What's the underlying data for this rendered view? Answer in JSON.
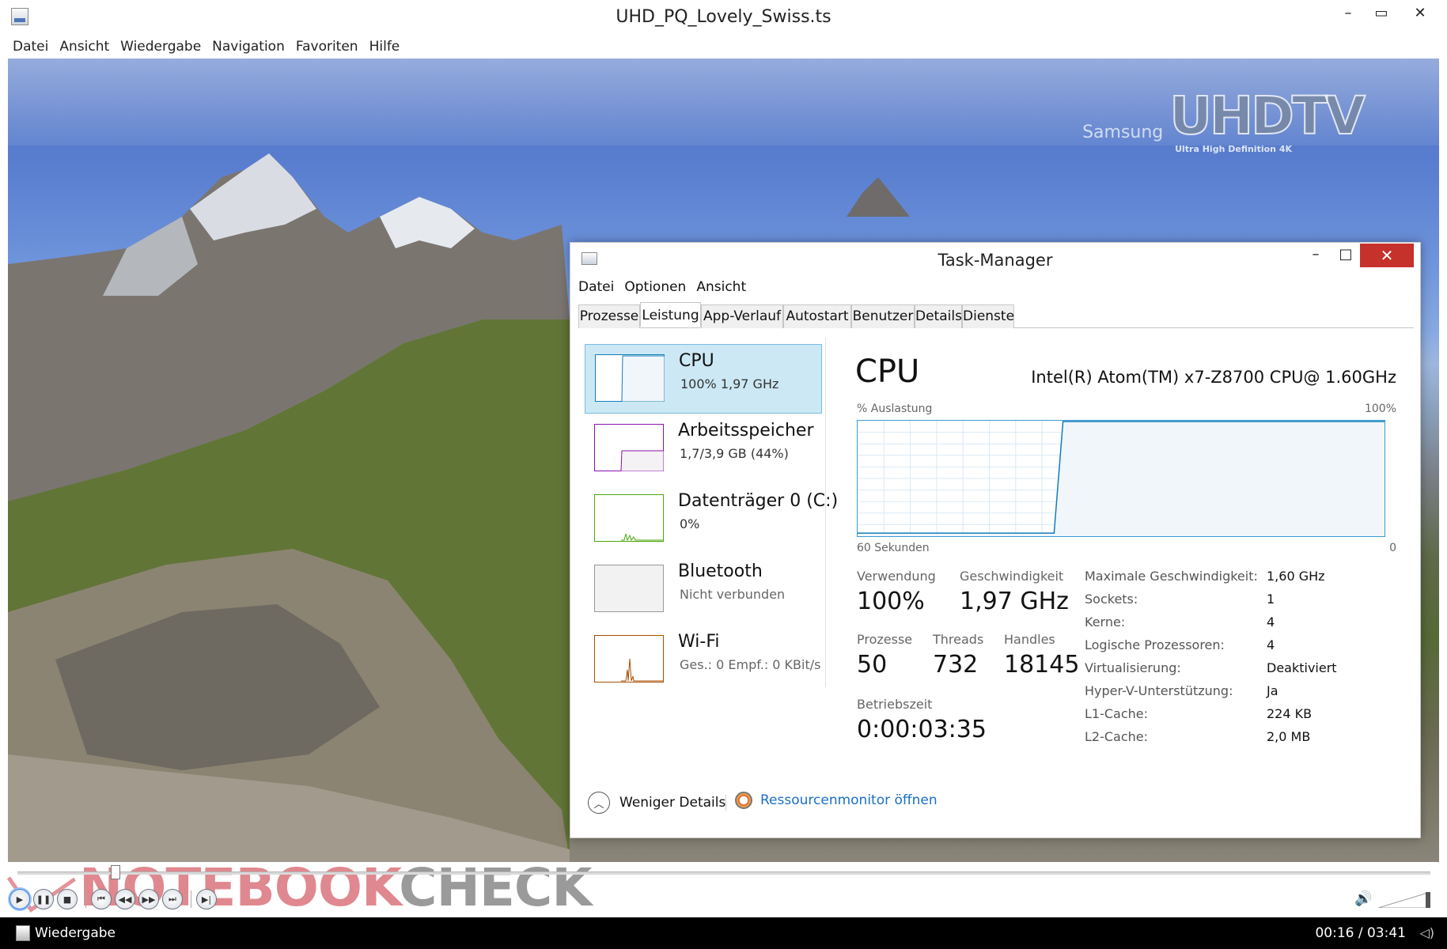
{
  "player": {
    "window_title": "UHD_PQ_Lovely_Swiss.ts",
    "controls": {
      "minimize": "–",
      "maximize": "▭",
      "close": "✕"
    },
    "menu": [
      "Datei",
      "Ansicht",
      "Wiedergabe",
      "Navigation",
      "Favoriten",
      "Hilfe"
    ],
    "brand": {
      "samsung": "Samsung",
      "uhdtv": "UHDTV",
      "sub": "Ultra High Definition 4K"
    },
    "watermark": {
      "left": "NOTEBOOK",
      "right": "CHECK"
    },
    "status": {
      "state": "Wiedergabe",
      "time": "00:16 / 03:41"
    },
    "icons": [
      "play-icon",
      "pause-icon",
      "stop-icon",
      "skip-back-icon",
      "rewind-icon",
      "forward-icon",
      "skip-forward-icon",
      "frame-step-icon",
      "volume-icon"
    ]
  },
  "taskmanager": {
    "title": "Task-Manager",
    "controls": {
      "minimize": "–",
      "maximize": "□",
      "close": "✕"
    },
    "menu": [
      "Datei",
      "Optionen",
      "Ansicht"
    ],
    "tabs": [
      "Prozesse",
      "Leistung",
      "App-Verlauf",
      "Autostart",
      "Benutzer",
      "Details",
      "Dienste"
    ],
    "active_tab": "Leistung",
    "sidebar": [
      {
        "name": "CPU",
        "sub": "100%  1,97 GHz",
        "color": "#117dbb",
        "selected": true
      },
      {
        "name": "Arbeitsspeicher",
        "sub": "1,7/3,9 GB (44%)",
        "color": "#8b12ae"
      },
      {
        "name": "Datenträger 0 (C:)",
        "sub": "0%",
        "color": "#4da60c"
      },
      {
        "name": "Bluetooth",
        "sub": "Nicht verbunden",
        "color": "#999999"
      },
      {
        "name": "Wi-Fi",
        "sub": "Ges.: 0  Empf.: 0 KBit/s",
        "color": "#a74f01"
      }
    ],
    "cpu": {
      "heading": "CPU",
      "model": "Intel(R) Atom(TM) x7-Z8700 CPU@ 1.60GHz",
      "graph_label_left": "% Auslastung",
      "graph_label_right": "100%",
      "axis_left": "60 Sekunden",
      "axis_right": "0",
      "usage_history_percent": [
        2,
        2,
        2,
        2,
        2,
        2,
        2,
        2,
        2,
        2,
        2,
        2,
        2,
        2,
        2,
        2,
        2,
        2,
        2,
        2,
        2,
        2,
        2,
        100,
        100,
        100,
        100,
        100,
        100,
        100,
        100,
        100,
        100,
        100,
        100,
        100,
        100,
        100,
        100,
        100,
        100,
        100,
        100,
        100,
        100,
        100,
        100,
        100,
        100,
        100,
        100,
        100,
        100,
        100,
        100,
        100,
        100,
        100,
        100,
        100
      ],
      "stats": {
        "usage_label": "Verwendung",
        "usage": "100%",
        "speed_label": "Geschwindigkeit",
        "speed": "1,97 GHz",
        "processes_label": "Prozesse",
        "processes": "50",
        "threads_label": "Threads",
        "threads": "732",
        "handles_label": "Handles",
        "handles": "18145",
        "uptime_label": "Betriebszeit",
        "uptime": "0:00:03:35"
      },
      "details": [
        {
          "k": "Maximale Geschwindigkeit:",
          "v": "1,60 GHz"
        },
        {
          "k": "Sockets:",
          "v": "1"
        },
        {
          "k": "Kerne:",
          "v": "4"
        },
        {
          "k": "Logische Prozessoren:",
          "v": "4"
        },
        {
          "k": "Virtualisierung:",
          "v": "Deaktiviert"
        },
        {
          "k": "Hyper-V-Unterstützung:",
          "v": "Ja"
        },
        {
          "k": "L1-Cache:",
          "v": "224 KB"
        },
        {
          "k": "L2-Cache:",
          "v": "2,0 MB"
        }
      ]
    },
    "footer": {
      "fewer_details": "Weniger Details",
      "resource_monitor": "Ressourcenmonitor öffnen"
    }
  }
}
